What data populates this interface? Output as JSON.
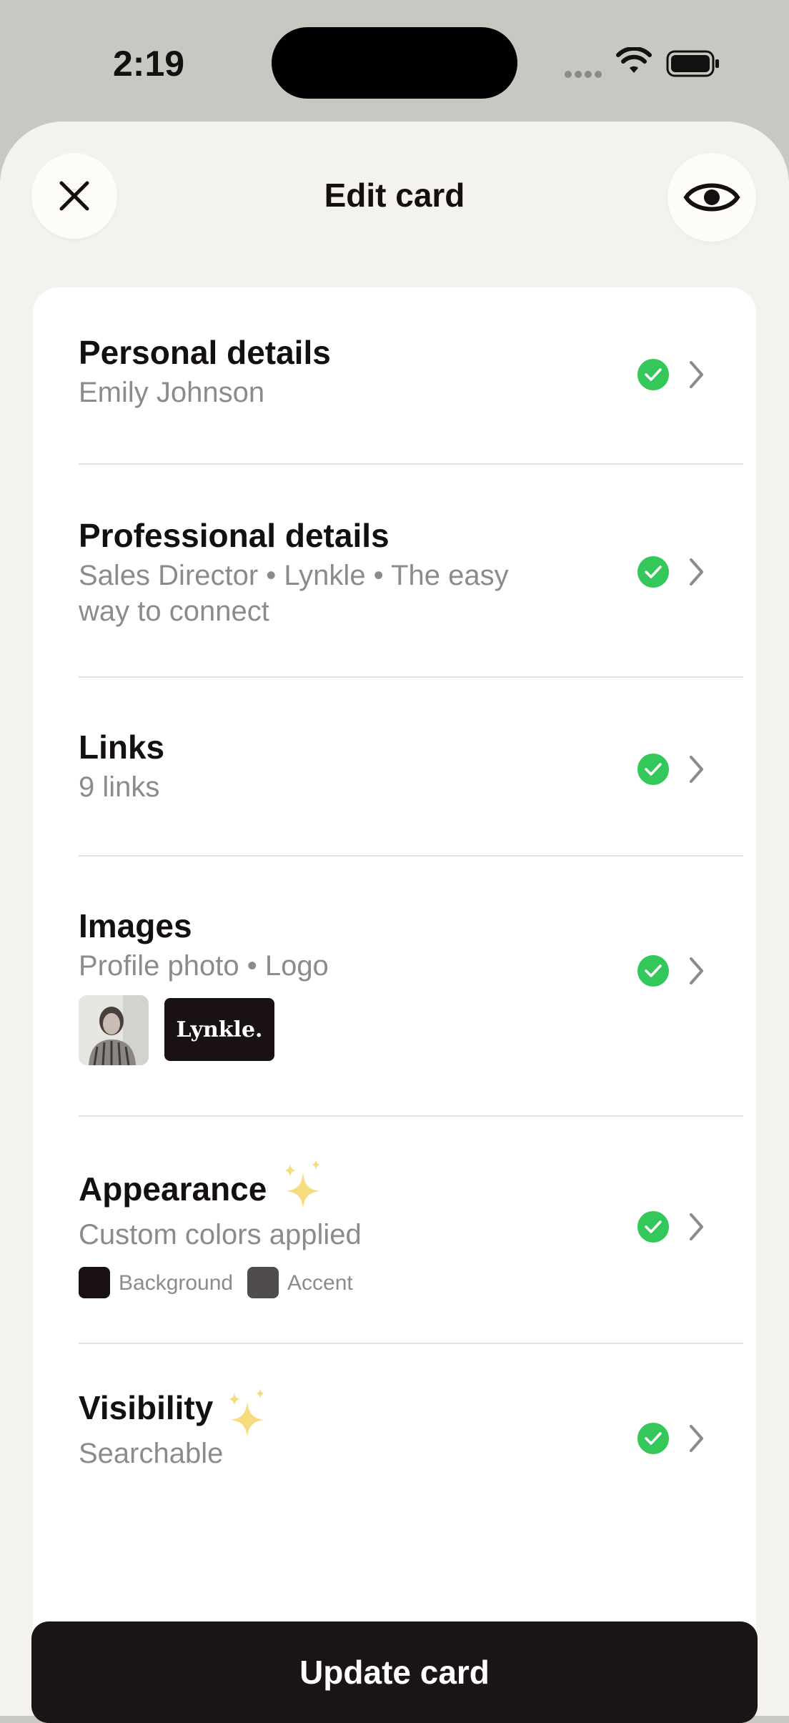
{
  "status_bar": {
    "time": "2:19"
  },
  "header": {
    "title": "Edit card"
  },
  "sections": [
    {
      "title": "Personal details",
      "subtitle": "Emily Johnson"
    },
    {
      "title": "Professional details",
      "subtitle": "Sales Director • Lynkle • The easy way to connect"
    },
    {
      "title": "Links",
      "subtitle": "9 links"
    },
    {
      "title": "Images",
      "subtitle": "Profile photo • Logo",
      "logo_text": "Lynkle."
    },
    {
      "title": "Appearance",
      "subtitle": "Custom colors applied",
      "swatches": [
        {
          "label": "Background",
          "color": "#1a1212"
        },
        {
          "label": "Accent",
          "color": "#4f4c4b"
        }
      ]
    },
    {
      "title": "Visibility",
      "subtitle": "Searchable"
    }
  ],
  "footer": {
    "button_label": "Update card"
  },
  "colors": {
    "check": "#34c759",
    "button": "#1a1414",
    "sparkle": "#f6dc7e"
  }
}
